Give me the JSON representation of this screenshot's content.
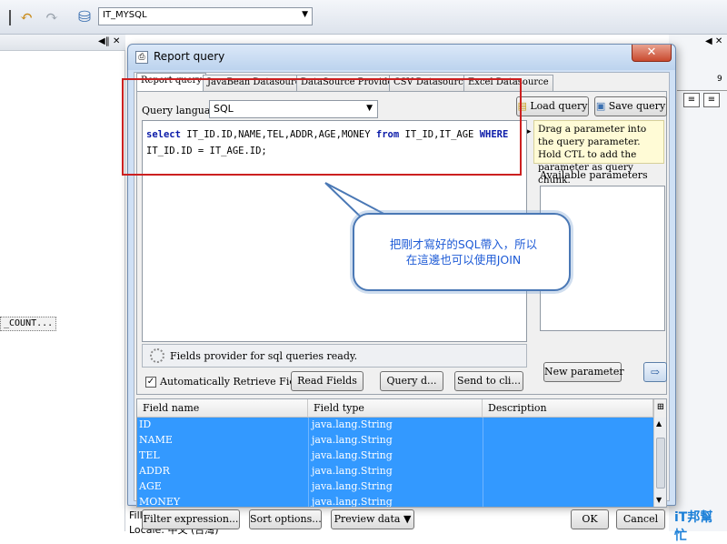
{
  "toolbar": {
    "datasource": "IT_MYSQL"
  },
  "left_panel": {
    "count_item": "_COUNT..."
  },
  "ruler": {
    "mark": "9"
  },
  "dialog": {
    "title": "Report query",
    "tabs": [
      "Report query",
      "JavaBean Datasource",
      "DataSource Provider",
      "CSV Datasource",
      "Excel Datasource"
    ],
    "query_language_label": "Query language",
    "query_language_value": "SQL",
    "load_query": "Load query",
    "save_query": "Save query",
    "sql": {
      "line1": [
        {
          "t": "select",
          "kw": true
        },
        {
          "t": " IT_ID.ID,NAME,TEL,ADDR,AGE,MONEY ",
          "kw": false
        },
        {
          "t": "from",
          "kw": true
        },
        {
          "t": " IT_ID,IT_AGE ",
          "kw": false
        },
        {
          "t": "WHERE",
          "kw": true
        }
      ],
      "line2": "IT_ID.ID = IT_AGE.ID;"
    },
    "status": "Fields provider for sql queries ready.",
    "auto_retrieve_label": "Automatically Retrieve Fields",
    "read_fields": "Read Fields",
    "query_designer": "Query d...",
    "send_to_clipboard": "Send to cli...",
    "hint": "Drag a parameter into the query parameter. Hold CTL to add the parameter as query chunk.",
    "available_parameters": "Available parameters",
    "new_parameter": "New parameter",
    "fields_table": {
      "headers": [
        "Field name",
        "Field type",
        "Description"
      ],
      "rows": [
        {
          "name": "ID",
          "type": "java.lang.String"
        },
        {
          "name": "NAME",
          "type": "java.lang.String"
        },
        {
          "name": "TEL",
          "type": "java.lang.String"
        },
        {
          "name": "ADDR",
          "type": "java.lang.String"
        },
        {
          "name": "AGE",
          "type": "java.lang.String"
        },
        {
          "name": "MONEY",
          "type": "java.lang.String"
        }
      ]
    },
    "filter_expression": "Filter expression...",
    "sort_options": "Sort options...",
    "preview_data": "Preview data",
    "ok": "OK",
    "cancel": "Cancel"
  },
  "callout": {
    "line1": "把剛才寫好的SQL帶入，所以",
    "line2": "在這邊也可以使用JOIN"
  },
  "status_bar": {
    "filling": "Filling report...",
    "locale": "Locale: 中文 (台灣)"
  },
  "watermark": {
    "text": "iT邦幫忙"
  },
  "colors": {
    "selection": "#3399ff",
    "callout_border": "#4a78b5",
    "highlight_box": "#cc2020",
    "keyword": "#0a1aa8"
  }
}
